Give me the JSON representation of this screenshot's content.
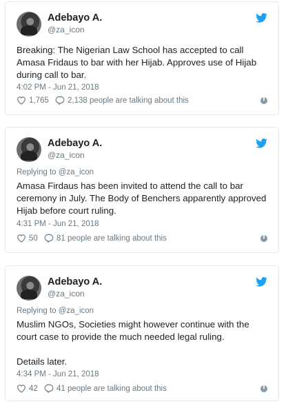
{
  "tweets": [
    {
      "name": "Adebayo A.",
      "handle": "@za_icon",
      "replying_prefix": "",
      "replying_handle": "",
      "text": "Breaking: The Nigerian Law School has accepted to call Amasa Fridaus to bar with her Hijab. Approves use of Hijab during call to bar.",
      "time": "4:02 PM - Jun 21, 2018",
      "likes": "1,765",
      "talking": "2,138 people are talking about this"
    },
    {
      "name": "Adebayo A.",
      "handle": "@za_icon",
      "replying_prefix": "Replying to",
      "replying_handle": "@za_icon",
      "text": "Amasa Firdaus has been invited to attend the call to bar ceremony in July. The Body of Benchers apparently approved Hijab before court ruling.",
      "time": "4:31 PM - Jun 21, 2018",
      "likes": "50",
      "talking": "81 people are talking about this"
    },
    {
      "name": "Adebayo A.",
      "handle": "@za_icon",
      "replying_prefix": "Replying to",
      "replying_handle": "@za_icon",
      "text": "Muslim NGOs, Societies might however continue with the court case to provide the much needed legal ruling.\n\nDetails later.",
      "time": "4:34 PM - Jun 21, 2018",
      "likes": "42",
      "talking": "41 people are talking about this"
    }
  ],
  "colors": {
    "twitter_blue": "#1da1f2",
    "muted": "#697882",
    "border": "#e1e8ed"
  },
  "icons": [
    "twitter-bird-icon",
    "heart-icon",
    "reply-bubble-icon",
    "info-icon"
  ]
}
